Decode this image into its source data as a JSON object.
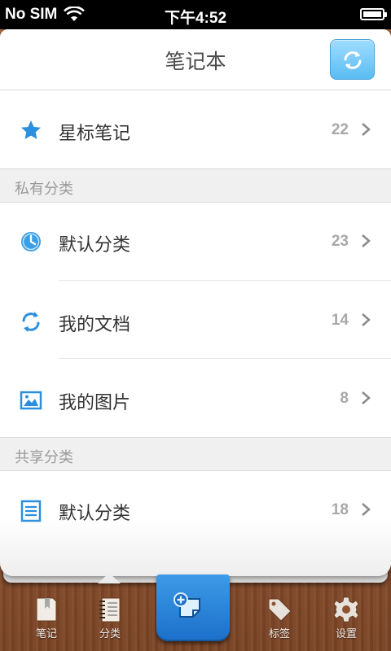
{
  "status_bar": {
    "carrier": "No SIM",
    "time": "下午4:52"
  },
  "nav": {
    "title": "笔记本"
  },
  "starred": {
    "label": "星标笔记",
    "count": "22",
    "icon": "star-icon"
  },
  "sections": {
    "private": {
      "header": "私有分类",
      "items": [
        {
          "label": "默认分类",
          "count": "23",
          "icon": "clock-icon"
        },
        {
          "label": "我的文档",
          "count": "14",
          "icon": "sync-document-icon"
        },
        {
          "label": "我的图片",
          "count": "8",
          "icon": "image-icon"
        }
      ]
    },
    "shared": {
      "header": "共享分类",
      "items": [
        {
          "label": "默认分类",
          "count": "18",
          "icon": "list-document-icon"
        }
      ]
    }
  },
  "tabs": [
    {
      "label": "笔记",
      "icon": "notebook-icon"
    },
    {
      "label": "分类",
      "icon": "spiral-notebook-icon",
      "selected": true
    },
    {
      "label": "",
      "icon": "compose-note-icon"
    },
    {
      "label": "标签",
      "icon": "tag-icon"
    },
    {
      "label": "设置",
      "icon": "gear-icon"
    }
  ],
  "colors": {
    "accent": "#3a9ee6",
    "wood": "#8e5230",
    "count_text": "#a8a8a8"
  }
}
